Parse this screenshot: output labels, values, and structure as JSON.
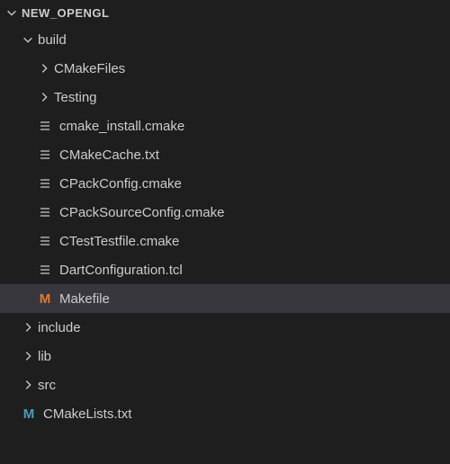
{
  "root": {
    "name": "NEW_OPENGL",
    "expanded": true
  },
  "tree": [
    {
      "label": "build",
      "type": "folder",
      "expanded": true,
      "depth": 1
    },
    {
      "label": "CMakeFiles",
      "type": "folder",
      "expanded": false,
      "depth": 2
    },
    {
      "label": "Testing",
      "type": "folder",
      "expanded": false,
      "depth": 2
    },
    {
      "label": "cmake_install.cmake",
      "type": "file",
      "icon": "lines",
      "depth": 2
    },
    {
      "label": "CMakeCache.txt",
      "type": "file",
      "icon": "lines",
      "depth": 2
    },
    {
      "label": "CPackConfig.cmake",
      "type": "file",
      "icon": "lines",
      "depth": 2
    },
    {
      "label": "CPackSourceConfig.cmake",
      "type": "file",
      "icon": "lines",
      "depth": 2
    },
    {
      "label": "CTestTestfile.cmake",
      "type": "file",
      "icon": "lines",
      "depth": 2
    },
    {
      "label": "DartConfiguration.tcl",
      "type": "file",
      "icon": "lines",
      "depth": 2
    },
    {
      "label": "Makefile",
      "type": "file",
      "icon": "M-orange",
      "depth": 2,
      "selected": true
    },
    {
      "label": "include",
      "type": "folder",
      "expanded": false,
      "depth": 1
    },
    {
      "label": "lib",
      "type": "folder",
      "expanded": false,
      "depth": 1
    },
    {
      "label": "src",
      "type": "folder",
      "expanded": false,
      "depth": 1
    },
    {
      "label": "CMakeLists.txt",
      "type": "file",
      "icon": "M-blue",
      "depth": 1
    }
  ]
}
